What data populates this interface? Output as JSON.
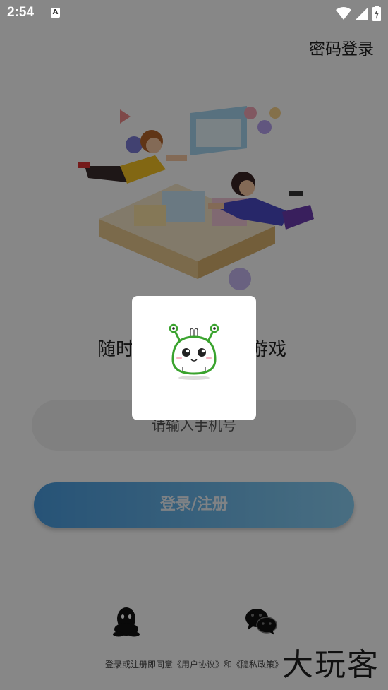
{
  "status_bar": {
    "time": "2:54",
    "notification_icon": "A"
  },
  "header": {
    "password_login": "密码登录"
  },
  "slogan": {
    "left_part": "随时",
    "right_part": "游戏"
  },
  "form": {
    "phone_placeholder": "请输入手机号",
    "login_button": "登录/注册"
  },
  "social": {
    "icons": [
      "qq-icon",
      "wechat-icon"
    ]
  },
  "agreement": "登录或注册即同意《用户协议》和《隐私政策》",
  "watermark": "大玩客",
  "colors": {
    "button_gradient_start": "#4a9de0",
    "button_gradient_end": "#8ad0f4",
    "overlay": "rgba(0,0,0,0.47)"
  }
}
